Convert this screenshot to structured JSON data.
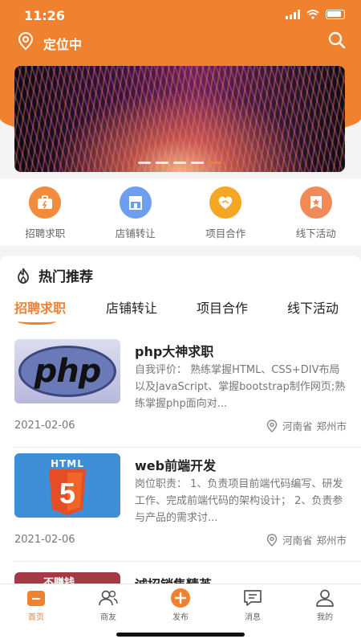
{
  "status_bar": {
    "time": "11:26"
  },
  "header": {
    "location_label": "定位中"
  },
  "banner": {
    "slide_count": 5,
    "active_slide": 4
  },
  "quick_nav": [
    {
      "label": "招聘求职",
      "icon": "briefcase-icon",
      "color": "#f28b3c"
    },
    {
      "label": "店铺转让",
      "icon": "store-icon",
      "color": "#6d9ef0"
    },
    {
      "label": "项目合作",
      "icon": "handshake-icon",
      "color": "#f5a623"
    },
    {
      "label": "线下活动",
      "icon": "star-badge-icon",
      "color": "#f08a56"
    }
  ],
  "hot_section": {
    "title": "热门推荐",
    "tabs": [
      "招聘求职",
      "店铺转让",
      "项目合作",
      "线下活动"
    ],
    "active_tab": 0,
    "cards": [
      {
        "thumb_text": "php",
        "title": "php大神求职",
        "desc": "自我评价：   熟练掌握HTML、CSS+DIV布局以及JavaScript、掌握bootstrap制作网页;熟练掌握php面向对...",
        "date": "2021-02-06",
        "province": "河南省",
        "city": "郑州市"
      },
      {
        "thumb_text": "HTML",
        "thumb_digit": "5",
        "title": "web前端开发",
        "desc": "岗位职责：   1、负责项目前端代码编写、研发工作、完成前端代码的架构设计；   2、负责参与产品的需求讨...",
        "date": "2021-02-06",
        "province": "河南省",
        "city": "郑州市"
      }
    ],
    "partial_card": {
      "thumb_text": "不赚钱",
      "title": "诚招销售精英"
    }
  },
  "tabbar": [
    {
      "label": "首页",
      "icon": "home-icon",
      "active": true
    },
    {
      "label": "商友",
      "icon": "friends-icon",
      "active": false
    },
    {
      "label": "发布",
      "icon": "plus-circle-icon",
      "active": false
    },
    {
      "label": "消息",
      "icon": "message-icon",
      "active": false
    },
    {
      "label": "我的",
      "icon": "user-icon",
      "active": false
    }
  ],
  "colors": {
    "accent": "#f0812f",
    "text_dark": "#222222",
    "text_gray": "#777777"
  }
}
